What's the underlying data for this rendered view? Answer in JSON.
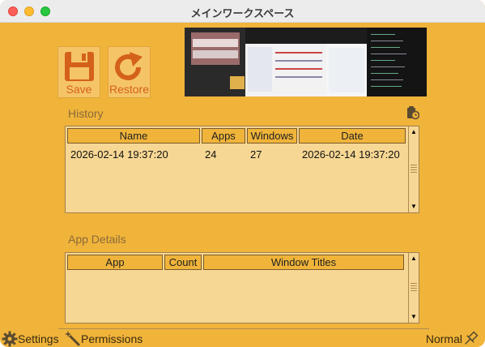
{
  "window": {
    "title": "メインワークスペース"
  },
  "toolbar": {
    "save_label": "Save",
    "restore_label": "Restore"
  },
  "history": {
    "title": "History",
    "columns": [
      "Name",
      "Apps",
      "Windows",
      "Date"
    ],
    "rows": [
      {
        "name": "2026-02-14 19:37:20",
        "apps": "24",
        "windows": "27",
        "date": "2026-02-14 19:37:20"
      }
    ]
  },
  "details": {
    "title": "App Details",
    "columns": [
      "App",
      "Count",
      "Window Titles"
    ]
  },
  "footer": {
    "settings_label": "Settings",
    "permissions_label": "Permissions",
    "mode_label": "Normal"
  },
  "icons": {
    "save": "floppy-disk-icon",
    "restore": "refresh-arrow-icon",
    "clipboard": "clipboard-clock-icon",
    "settings": "gear-icon",
    "permissions": "magic-wand-icon",
    "mode": "pin-icon"
  },
  "colors": {
    "background": "#f0b43a",
    "table_fill": "#f7d794",
    "accent_text": "#d4611a"
  }
}
